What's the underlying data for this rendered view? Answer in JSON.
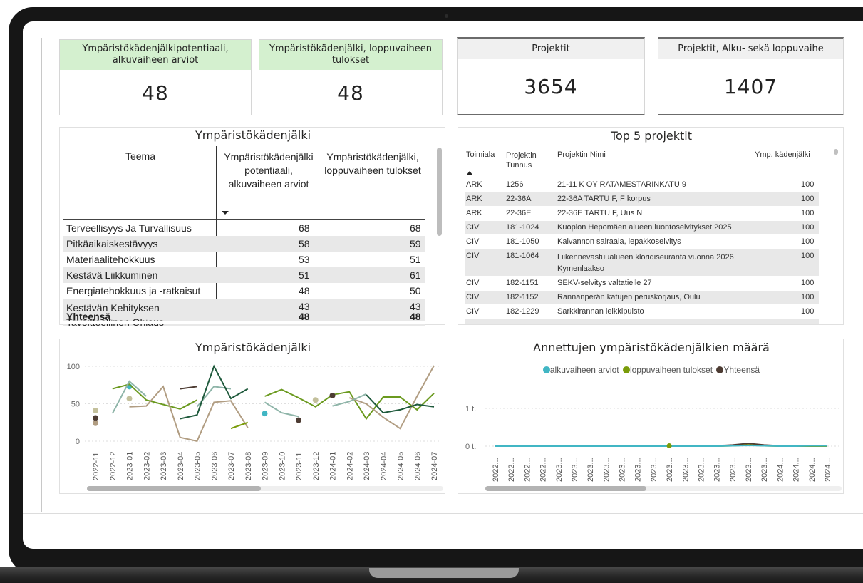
{
  "kpis": [
    {
      "title": "Ympäristökädenjälkipotentiaali, alkuvaiheen arviot",
      "value": "48"
    },
    {
      "title": "Ympäristökädenjälki, loppuvaiheen tulokset",
      "value": "48"
    },
    {
      "title": "Projektit",
      "value": "3654"
    },
    {
      "title": "Projektit, Alku- sekä loppuvaihe",
      "value": "1407"
    }
  ],
  "theme_table": {
    "title": "Ympäristökädenjälki",
    "headers": [
      "Teema",
      "Ympäristökädenjälki potentiaali, alkuvaiheen arviot",
      "Ympäristökädenjälki, loppuvaiheen tulokset"
    ],
    "rows": [
      {
        "teema": "Terveellisyys Ja Turvallisuus",
        "a": "68",
        "b": "68"
      },
      {
        "teema": "Pitkäaikaiskestävyys",
        "a": "58",
        "b": "59"
      },
      {
        "teema": "Materiaalitehokkuus",
        "a": "53",
        "b": "51"
      },
      {
        "teema": "Kestävä Liikkuminen",
        "a": "51",
        "b": "61"
      },
      {
        "teema": "Energiatehokkuus ja -ratkaisut",
        "a": "48",
        "b": "50"
      },
      {
        "teema": "Kestävän Kehityksen Tavoitteellinen Ohiaus",
        "a": "43",
        "b": "43"
      }
    ],
    "total": {
      "label": "Yhteensä",
      "a": "48",
      "b": "48"
    }
  },
  "top_projects": {
    "title": "Top 5 projektit",
    "headers": {
      "toimiala": "Toimiala",
      "tunnus": "Projektin Tunnus",
      "nimi": "Projektin Nimi",
      "kadenjalki": "Ymp. kädenjälki"
    },
    "rows": [
      {
        "toimiala": "ARK",
        "tunnus": "1256",
        "nimi": "21-11 K OY RATAMESTARINKATU 9",
        "value": "100"
      },
      {
        "toimiala": "ARK",
        "tunnus": "22-36A",
        "nimi": "22-36A TARTU F, F korpus",
        "value": "100"
      },
      {
        "toimiala": "ARK",
        "tunnus": "22-36E",
        "nimi": "22-36E TARTU F, Uus N",
        "value": "100"
      },
      {
        "toimiala": "CIV",
        "tunnus": "181-1024",
        "nimi": "Kuopion Hepomäen alueen luontoselvitykset 2025",
        "value": "100"
      },
      {
        "toimiala": "CIV",
        "tunnus": "181-1050",
        "nimi": "Kaivannon sairaala, lepakkoselvitys",
        "value": "100"
      },
      {
        "toimiala": "CIV",
        "tunnus": "181-1064",
        "nimi": "Liikennevastuualueen kloridiseuranta vuonna 2026 Kymenlaakso",
        "value": "100"
      },
      {
        "toimiala": "CIV",
        "tunnus": "182-1151",
        "nimi": "SEKV-selvitys valtatielle 27",
        "value": "100"
      },
      {
        "toimiala": "CIV",
        "tunnus": "182-1152",
        "nimi": "Rannanperän katujen peruskorjaus, Oulu",
        "value": "100"
      },
      {
        "toimiala": "CIV",
        "tunnus": "182-1229",
        "nimi": "Sarkkirannan leikkipuisto",
        "value": "100"
      }
    ]
  },
  "colors": {
    "teal": "#41b6c4",
    "green": "#7a9c0a",
    "darkbrown": "#4d3c33",
    "khaki": "#c3c09b",
    "tan": "#b19d82",
    "sage": "#8fb5a9",
    "darkgreen": "#1f5a3c",
    "lime": "#6b9a1f",
    "kpiGreen": "#d4f0cf"
  },
  "chart_data": [
    {
      "type": "line",
      "title": "Ympäristökädenjälki",
      "ylim": [
        0,
        100
      ],
      "yticks": [
        "0",
        "50",
        "100"
      ],
      "categories": [
        "2022-11",
        "2022-12",
        "2023-01",
        "2023-02",
        "2023-03",
        "2023-04",
        "2023-05",
        "2023-06",
        "2023-07",
        "2023-08",
        "2023-09",
        "2023-10",
        "2023-11",
        "2023-12",
        "2024-01",
        "2024-02",
        "2024-03",
        "2024-04",
        "2024-05",
        "2024-06",
        "2024-07"
      ],
      "series": [
        {
          "color": "#41b6c4",
          "values": [
            null,
            null,
            73,
            null,
            null,
            null,
            null,
            null,
            null,
            null,
            37,
            null,
            null,
            null,
            null,
            null,
            null,
            null,
            null,
            null,
            null
          ],
          "dots": [
            2,
            10
          ]
        },
        {
          "color": "#6b9a1f",
          "values": [
            null,
            70,
            76,
            55,
            49,
            43,
            55,
            null,
            null,
            null,
            60,
            69,
            58,
            46,
            62,
            66,
            30,
            59,
            59,
            42,
            64
          ]
        },
        {
          "color": "#4d3c33",
          "values": [
            31,
            null,
            46,
            null,
            null,
            70,
            73,
            null,
            null,
            null,
            null,
            null,
            28,
            null,
            61,
            null,
            null,
            null,
            null,
            null,
            null
          ],
          "dots": [
            0,
            12,
            14
          ]
        },
        {
          "color": "#c3c09b",
          "values": [
            41,
            null,
            57,
            null,
            null,
            null,
            null,
            null,
            null,
            null,
            null,
            null,
            null,
            55,
            null,
            null,
            null,
            null,
            null,
            null,
            null
          ],
          "dots": [
            0,
            2,
            13,
            17,
            19
          ]
        },
        {
          "color": "#b19d82",
          "values": [
            24,
            null,
            46,
            47,
            73,
            5,
            0,
            52,
            54,
            18,
            null,
            null,
            null,
            null,
            null,
            58,
            50,
            32,
            17,
            60,
            101
          ],
          "dots": [
            0
          ]
        },
        {
          "color": "#8fb5a9",
          "values": [
            null,
            37,
            80,
            60,
            null,
            null,
            46,
            73,
            70,
            null,
            52,
            38,
            33,
            null,
            47,
            53,
            63,
            null,
            null,
            null,
            null
          ]
        },
        {
          "color": "#1f5a3c",
          "values": [
            null,
            null,
            null,
            null,
            null,
            30,
            35,
            100,
            57,
            70,
            null,
            null,
            40,
            null,
            33,
            null,
            62,
            38,
            42,
            49,
            46
          ],
          "dots": [
            0,
            2
          ]
        },
        {
          "color": "#7a9c0a",
          "values": [
            null,
            null,
            null,
            null,
            null,
            null,
            null,
            null,
            17,
            25,
            null,
            null,
            null,
            null,
            null,
            null,
            null,
            null,
            null,
            null,
            null
          ]
        }
      ]
    },
    {
      "type": "line",
      "title": "Annettujen ympäristökädenjälkien määrä",
      "ytick_labels": [
        "0 t.",
        "1 t."
      ],
      "legend": [
        "alkuvaiheen arviot",
        "loppuvaiheen tulokset",
        "Yhteensä"
      ],
      "legend_colors": [
        "#41b6c4",
        "#7a9c0a",
        "#4d3c33"
      ],
      "legend_position": "top",
      "x_labels": [
        "2022...",
        "2022...",
        "2022...",
        "2022...",
        "2023...",
        "2023...",
        "2023...",
        "2023...",
        "2023...",
        "2023...",
        "2023...",
        "2023...",
        "2023...",
        "2023...",
        "2023...",
        "2023...",
        "2023...",
        "2023...",
        "2024...",
        "2024...",
        "2024...",
        "2024..."
      ],
      "series": [
        {
          "name": "Yhteensä",
          "color": "#4d3c33",
          "values": [
            0,
            0,
            0,
            0.02,
            0,
            0,
            0,
            0,
            0,
            0.01,
            0,
            0,
            0,
            0,
            0.01,
            0.03,
            0.07,
            0.03,
            0.01,
            0.01,
            0.02,
            0.02
          ]
        },
        {
          "name": "loppuvaiheen tulokset",
          "color": "#7a9c0a",
          "values": [
            0,
            0,
            0,
            0.01,
            0,
            0,
            0,
            0,
            0,
            0,
            0,
            0,
            0,
            0,
            0,
            0.01,
            0.03,
            0.01,
            0,
            0,
            0,
            0
          ]
        },
        {
          "name": "alkuvaiheen arviot",
          "color": "#41b6c4",
          "values": [
            0,
            0,
            0,
            0,
            0,
            0,
            0,
            0,
            0,
            0,
            0,
            0,
            0,
            0,
            0,
            0.01,
            0.02,
            0.01,
            0,
            0,
            0.01,
            0.01
          ]
        }
      ]
    }
  ]
}
